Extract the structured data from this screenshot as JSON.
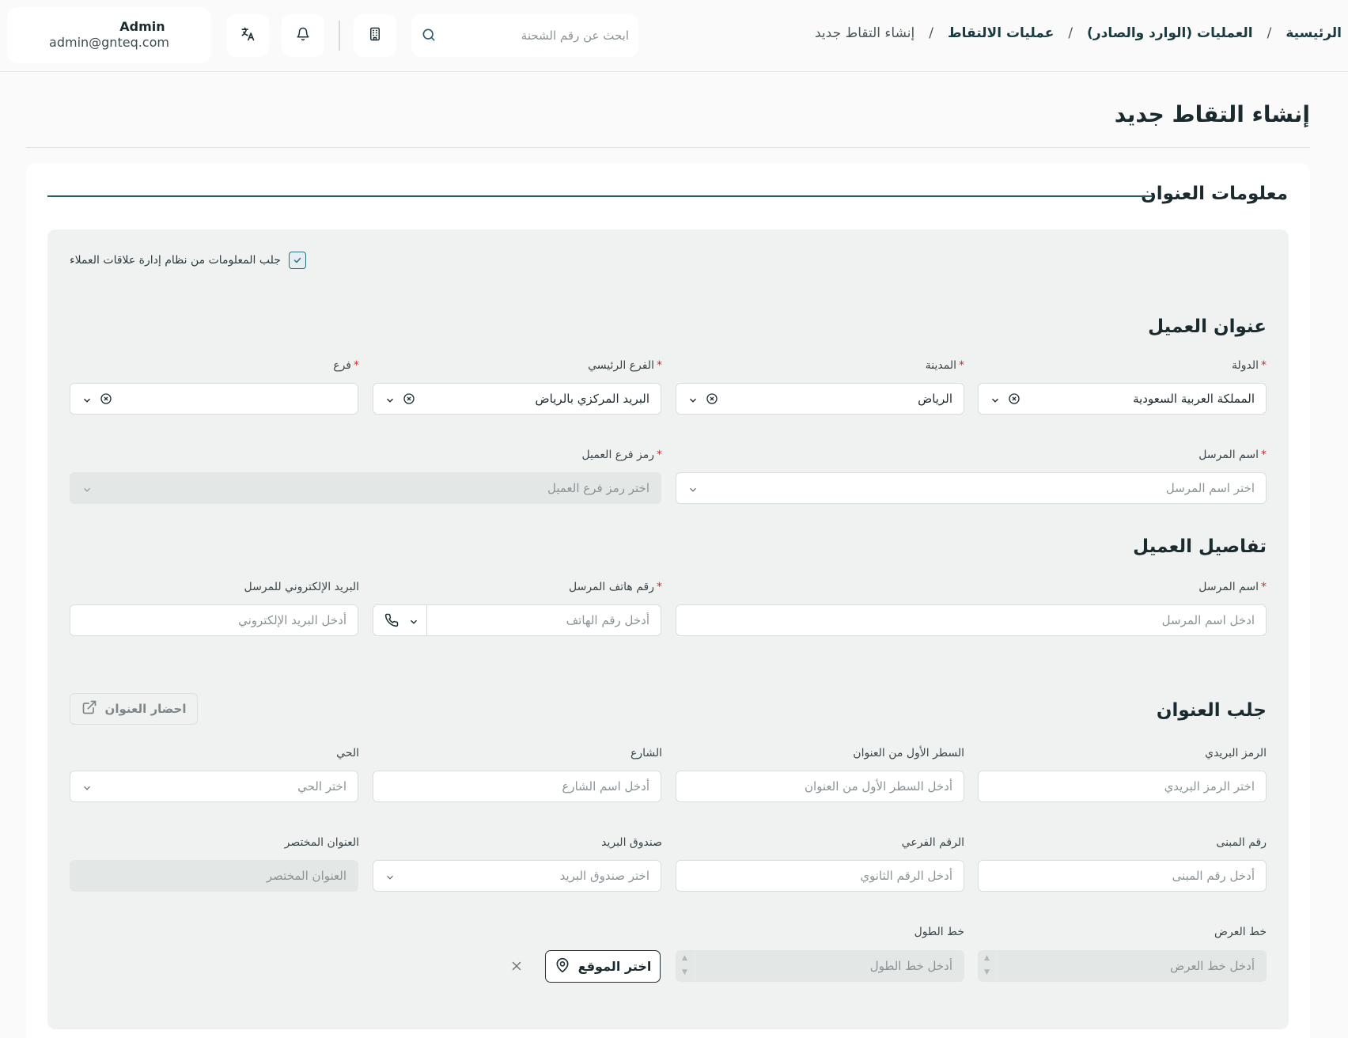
{
  "header": {
    "user": {
      "name": "Admin",
      "email": "admin@gnteq.com"
    },
    "icons": {
      "translate": "translate-icon",
      "bell": "bell-icon",
      "building": "building-icon",
      "search": "search-icon"
    },
    "search": {
      "placeholder": "ابحث عن رقم الشحنة"
    },
    "breadcrumb": {
      "items": [
        "الرئيسية",
        "العمليات (الوارد والصادر)",
        "عمليات الالتقاط",
        "إنشاء التقاط جديد"
      ],
      "separator": "/"
    }
  },
  "page": {
    "title": "إنشاء التقاط جديد"
  },
  "form": {
    "section_title": "معلومات العنوان",
    "crm_checkbox": {
      "label": "جلب المعلومات من نظام إدارة علاقات العملاء",
      "checked": true
    },
    "customer_address": {
      "title": "عنوان العميل",
      "country": {
        "label": "الدولة",
        "value": "المملكة العربية السعودية"
      },
      "city": {
        "label": "المدينة",
        "value": "الرياض"
      },
      "main_branch": {
        "label": "الفرع الرئيسي",
        "value": "البريد المركزي بالرياض"
      },
      "branch": {
        "label": "فرع",
        "value": ""
      },
      "sender_name": {
        "label": "اسم المرسل",
        "placeholder": "اختر اسم المرسل"
      },
      "client_branch_code": {
        "label": "رمز فرع العميل",
        "placeholder": "اختر رمز فرع العميل"
      }
    },
    "customer_details": {
      "title": "تفاصيل العميل",
      "sender_name": {
        "label": "اسم المرسل",
        "placeholder": "ادخل اسم المرسل"
      },
      "sender_phone": {
        "label": "رقم هاتف المرسل",
        "placeholder": "أدخل رقم الهاتف"
      },
      "sender_email": {
        "label": "البريد الإلكتروني للمرسل",
        "placeholder": "أدخل البريد الإلكتروني"
      }
    },
    "fetch_address": {
      "title": "جلب العنوان",
      "button_label": "احضار العنوان",
      "postal_code": {
        "label": "الرمز البريدي",
        "placeholder": "اختر الرمز البريدي"
      },
      "address_line1": {
        "label": "السطر الأول من العنوان",
        "placeholder": "أدخل السطر الأول من العنوان"
      },
      "street": {
        "label": "الشارع",
        "placeholder": "أدخل اسم الشارع"
      },
      "district": {
        "label": "الحي",
        "placeholder": "اختر الحي"
      },
      "building_number": {
        "label": "رقم المبنى",
        "placeholder": "أدخل رقم المبنى"
      },
      "sub_number": {
        "label": "الرقم الفرعي",
        "placeholder": "أدخل الرقم الثانوي"
      },
      "po_box": {
        "label": "صندوق البريد",
        "placeholder": "اختر صندوق البريد"
      },
      "short_address": {
        "label": "العنوان المختصر",
        "placeholder": "العنوان المختصر"
      },
      "latitude": {
        "label": "خط العرض",
        "placeholder": "أدخل خط العرض"
      },
      "longitude": {
        "label": "خط الطول",
        "placeholder": "أدخل خط الطول"
      },
      "pick_location_label": "اختر الموقع"
    }
  },
  "colors": {
    "accent": "#2e5c66",
    "required": "#e02424",
    "inner_bg": "#f0f2f1"
  }
}
